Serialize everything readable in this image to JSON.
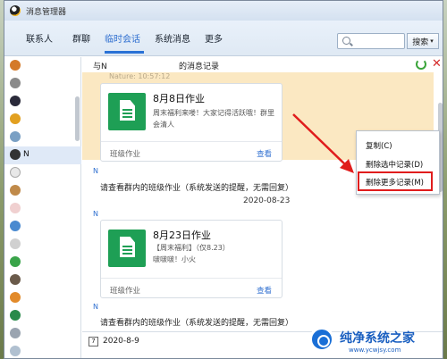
{
  "window": {
    "title": "消息管理器"
  },
  "tabs": [
    {
      "label": "联系人"
    },
    {
      "label": "群聊"
    },
    {
      "label": "临时会话"
    },
    {
      "label": "系统消息"
    },
    {
      "label": "更多"
    }
  ],
  "search": {
    "button_label": "搜索"
  },
  "contacts": {
    "selected_name": "N"
  },
  "chat_header": {
    "with_label": "与N",
    "record_label": "的消息记录"
  },
  "faded_time": "Nature: 10:57:12",
  "messages": {
    "card1": {
      "title": "8月8日作业",
      "desc": "周末福利来喽！大家记得活跃哦！群里会清人",
      "category": "班级作业",
      "view": "查看"
    },
    "sender1": "N",
    "system_notice_1": "请查看群内的班级作业（系统发送的提醒，无需回复）",
    "date_sep": "2020-08-23",
    "sender2": "N",
    "card2": {
      "title": "8月23日作业",
      "desc_line1": "【周末福利】（仅8.23）",
      "desc_line2": "啵啵啵！小火",
      "category": "班级作业",
      "view": "查看"
    },
    "sender3": "N",
    "system_notice_2": "请查看群内的班级作业（系统发送的提醒，无需回复）"
  },
  "bottom": {
    "date": "2020-8-9"
  },
  "context_menu": {
    "items": [
      {
        "label": "复制(C)"
      },
      {
        "label": "删除选中记录(D)"
      },
      {
        "label": "删除更多记录(M)"
      }
    ]
  },
  "watermark": {
    "title": "纯净系统之家",
    "url": "www.ycwjsy.com"
  },
  "colors": {
    "accent": "#2f6fd0",
    "card_icon": "#1e9f55",
    "highlight": "#fbe8c2",
    "alert_red": "#e01c1c"
  }
}
